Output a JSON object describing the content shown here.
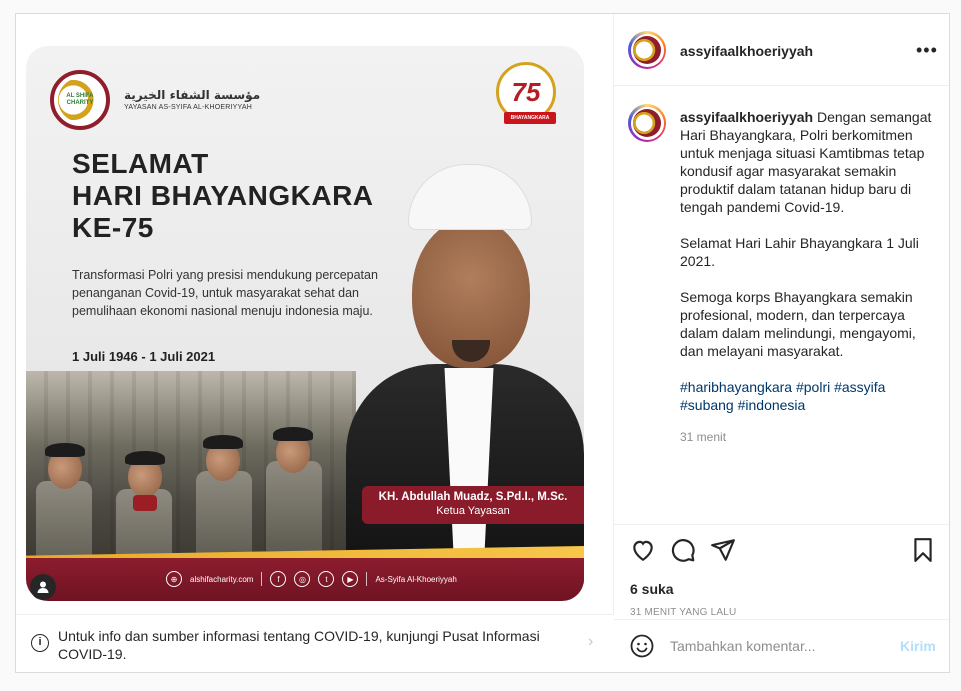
{
  "post": {
    "username": "assyifaalkhoeriyyah",
    "caption_paragraphs": [
      "Dengan semangat Hari Bhayangkara, Polri berkomitmen untuk menjaga situasi Kamtibmas tetap kondusif agar masyarakat semakin produktif dalam tatanan hidup baru di tengah pandemi Covid-19.",
      "Selamat Hari Lahir Bhayangkara 1 Juli 2021.",
      "Semoga korps Bhayangkara semakin profesional, modern, dan terpercaya dalam dalam melindungi, mengayomi, dan melayani masyarakat."
    ],
    "hashtags": "#haribhayangkara #polri #assyifa #subang #indonesia",
    "caption_time": "31 menit",
    "likes": "6 suka",
    "time_ago": "31 MENIT YANG LALU"
  },
  "poster": {
    "logo_text": "AL SHIFA CHARITY",
    "org_arabic": "مؤسسة الشفاء الخيرية",
    "org_name": "YAYASAN AS-SYIFA AL-KHOERIYYAH",
    "badge_number": "75",
    "badge_ribbon": "BHAYANGKARA",
    "title_lines": [
      "SELAMAT",
      "HARI BHAYANGKARA",
      "KE-75"
    ],
    "description": "Transformasi Polri yang presisi mendukung percepatan penanganan Covid-19, untuk masyarakat sehat dan pemulihaan ekonomi nasional menuju indonesia maju.",
    "dates": "1 Juli 1946 - 1 Juli 2021",
    "person_name": "KH. Abdullah Muadz, S.Pd.I., M.Sc.",
    "person_role": "Ketua Yayasan",
    "footer_website": "alshifacharity.com",
    "footer_handle": "As-Syifa Al-Khoeriyyah"
  },
  "covid_notice": "Untuk info dan sumber informasi tentang COVID-19, kunjungi Pusat Informasi COVID-19.",
  "comment": {
    "placeholder": "Tambahkan komentar...",
    "post_label": "Kirim"
  },
  "icons": {
    "more": "more-options-icon",
    "like": "heart-icon",
    "comment": "comment-icon",
    "share": "share-icon",
    "save": "bookmark-icon",
    "emoji": "emoji-icon",
    "info": "info-icon",
    "tag": "user-tag-icon"
  }
}
